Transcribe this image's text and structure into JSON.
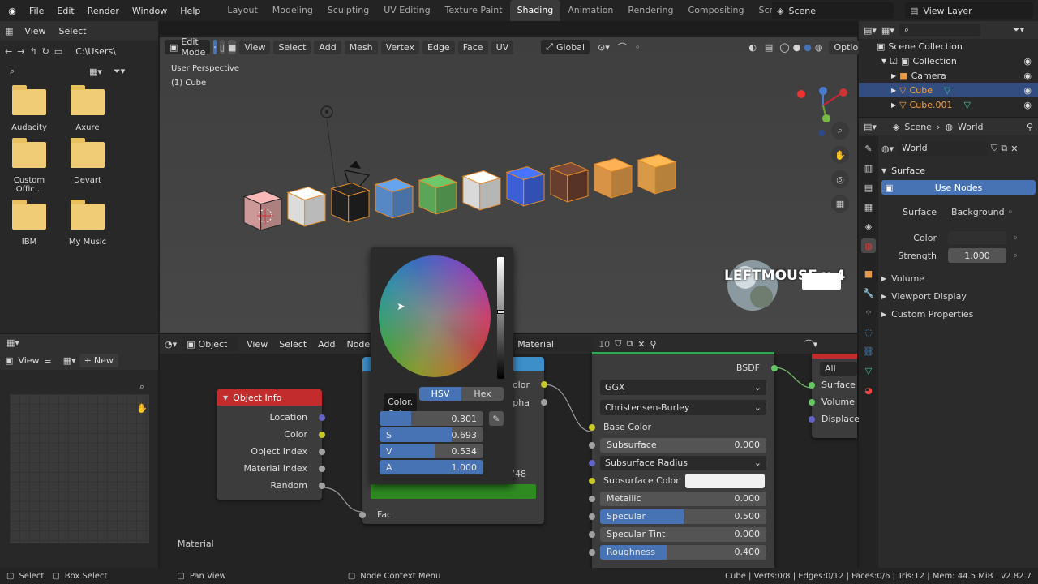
{
  "topbar": {
    "menus": [
      "File",
      "Edit",
      "Render",
      "Window",
      "Help"
    ],
    "workspaces": [
      "Layout",
      "Modeling",
      "Sculpting",
      "UV Editing",
      "Texture Paint",
      "Shading",
      "Animation",
      "Rendering",
      "Compositing",
      "Scripting"
    ],
    "active_workspace": "Shading",
    "scene": "Scene",
    "view_layer": "View Layer"
  },
  "filebrowser": {
    "view": "View",
    "select": "Select",
    "path": "C:\\Users\\...",
    "items": [
      "Audacity",
      "Axure",
      "Custom Offic...",
      "Devart",
      "IBM",
      "My Music"
    ]
  },
  "viewport": {
    "mode": "Edit Mode",
    "menus": [
      "View",
      "Select",
      "Add",
      "Mesh",
      "Vertex",
      "Edge",
      "Face",
      "UV"
    ],
    "orientation": "Global",
    "options": "Options",
    "perspective": "User Perspective",
    "object": "(1) Cube",
    "overlay_text": "LEFTMOUSE x 4",
    "cube_colors": [
      "#d8a0a0",
      "#e8e8e8",
      "#222222",
      "#5a8fd0",
      "#5fae5c",
      "#e4e4e4",
      "#3f64e0",
      "#6b4030",
      "#e39b4a",
      "#e3a24a"
    ]
  },
  "image_editor": {
    "view": "View",
    "new": "New"
  },
  "node_editor": {
    "editor": "Object",
    "menus": [
      "View",
      "Select",
      "Add",
      "Node"
    ],
    "material": "Material",
    "users": "10",
    "material_label": "Material",
    "object_info": {
      "title": "Object Info",
      "outputs": [
        "Location",
        "Color",
        "Object Index",
        "Material Index",
        "Random"
      ]
    },
    "fac_label": "Fac",
    "partial_labels": [
      "Color",
      "lpha"
    ],
    "partial_value": "748",
    "bsdf": {
      "out": "BSDF",
      "distribution": "GGX",
      "subsurface_method": "Christensen-Burley",
      "rows": [
        {
          "label": "Base Color",
          "type": "label"
        },
        {
          "label": "Subsurface",
          "value": "0.000",
          "fill": 0
        },
        {
          "label": "Subsurface Radius",
          "type": "dropdown"
        },
        {
          "label": "Subsurface Color",
          "type": "color"
        },
        {
          "label": "Metallic",
          "value": "0.000",
          "fill": 0
        },
        {
          "label": "Specular",
          "value": "0.500",
          "fill": 0.5
        },
        {
          "label": "Specular Tint",
          "value": "0.000",
          "fill": 0
        },
        {
          "label": "Roughness",
          "value": "0.400",
          "fill": 0.4
        }
      ]
    },
    "output": {
      "target": "All",
      "inputs": [
        "Surface",
        "Volume",
        "Displace"
      ]
    }
  },
  "color_picker": {
    "tabs": [
      "HSV",
      "Hex"
    ],
    "tooltip": [
      "Color.",
      "Color."
    ],
    "h": {
      "label": "",
      "value": "0.301",
      "fill": 0.301
    },
    "s": {
      "label": "S",
      "value": "0.693",
      "fill": 0.693
    },
    "v": {
      "label": "V",
      "value": "0.534",
      "fill": 0.534
    },
    "a": {
      "label": "A",
      "value": "1.000",
      "fill": 1.0
    },
    "swatch": "#2f8a22"
  },
  "outliner": {
    "scene_collection": "Scene Collection",
    "items": [
      {
        "name": "Collection",
        "selected": false
      },
      {
        "name": "Camera",
        "selected": false
      },
      {
        "name": "Cube",
        "selected": true
      },
      {
        "name": "Cube.001",
        "selected": false
      }
    ]
  },
  "properties": {
    "tabs": [
      "Scene",
      "World"
    ],
    "world_name": "World",
    "surface_panel": "Surface",
    "use_nodes": "Use Nodes",
    "surface_label": "Surface",
    "surface_value": "Background",
    "color_label": "Color",
    "strength_label": "Strength",
    "strength_value": "1.000",
    "panels": [
      "Volume",
      "Viewport Display",
      "Custom Properties"
    ]
  },
  "statusbar": {
    "left": [
      "Select",
      "Box Select",
      "Pan View",
      "Node Context Menu"
    ],
    "right": "Cube | Verts:0/8 | Edges:0/12 | Faces:0/6 | Tris:12 | Mem: 44.5 MiB | v2.82.7"
  },
  "colors": {
    "accent": "#4772b3",
    "selected_row": "#334d80",
    "object_info_header": "#c22c2c",
    "node_green": "#2f8a22"
  }
}
